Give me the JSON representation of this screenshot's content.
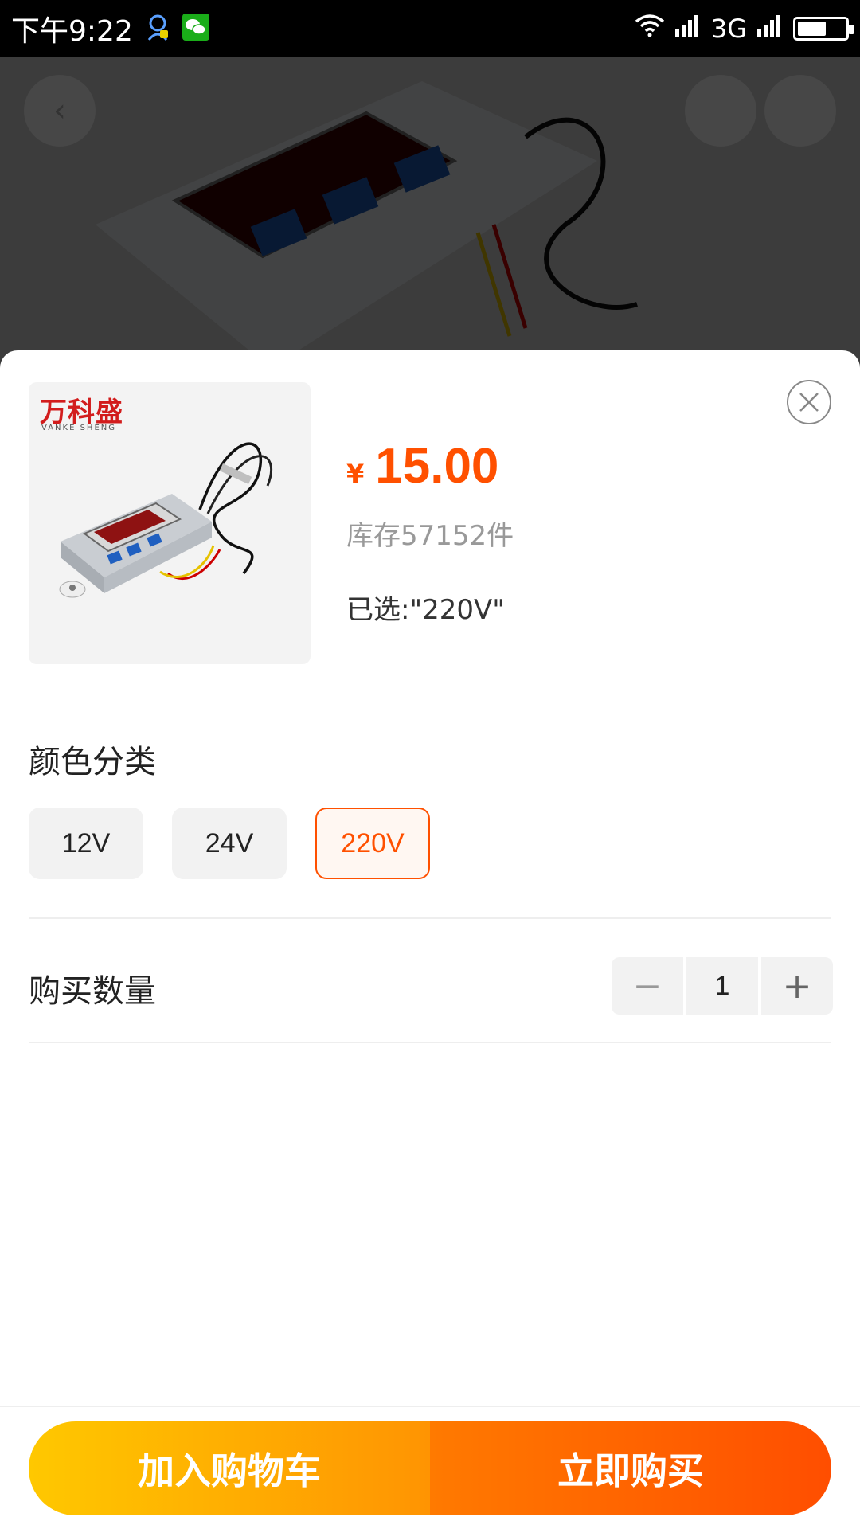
{
  "status_bar": {
    "time": "下午9:22",
    "network": "3G",
    "battery_level": 0.6
  },
  "product": {
    "brand_logo_text": "万科盛",
    "brand_sub_text": "VANKE SHENG",
    "price_symbol": "¥",
    "price": "15.00",
    "stock": "库存57152件",
    "selected": "已选:\"220V\""
  },
  "variants": {
    "title": "颜色分类",
    "options": [
      "12V",
      "24V",
      "220V"
    ],
    "selected": "220V"
  },
  "quantity": {
    "label": "购买数量",
    "minus": "−",
    "value": "1",
    "plus": "+"
  },
  "actions": {
    "add_to_cart": "加入购物车",
    "buy_now": "立即购买"
  },
  "colors": {
    "accent": "#ff5000",
    "cart_gradient_start": "#ffc800",
    "cart_gradient_end": "#ff9402",
    "buy_gradient_start": "#ff7a00",
    "buy_gradient_end": "#ff4e00"
  }
}
